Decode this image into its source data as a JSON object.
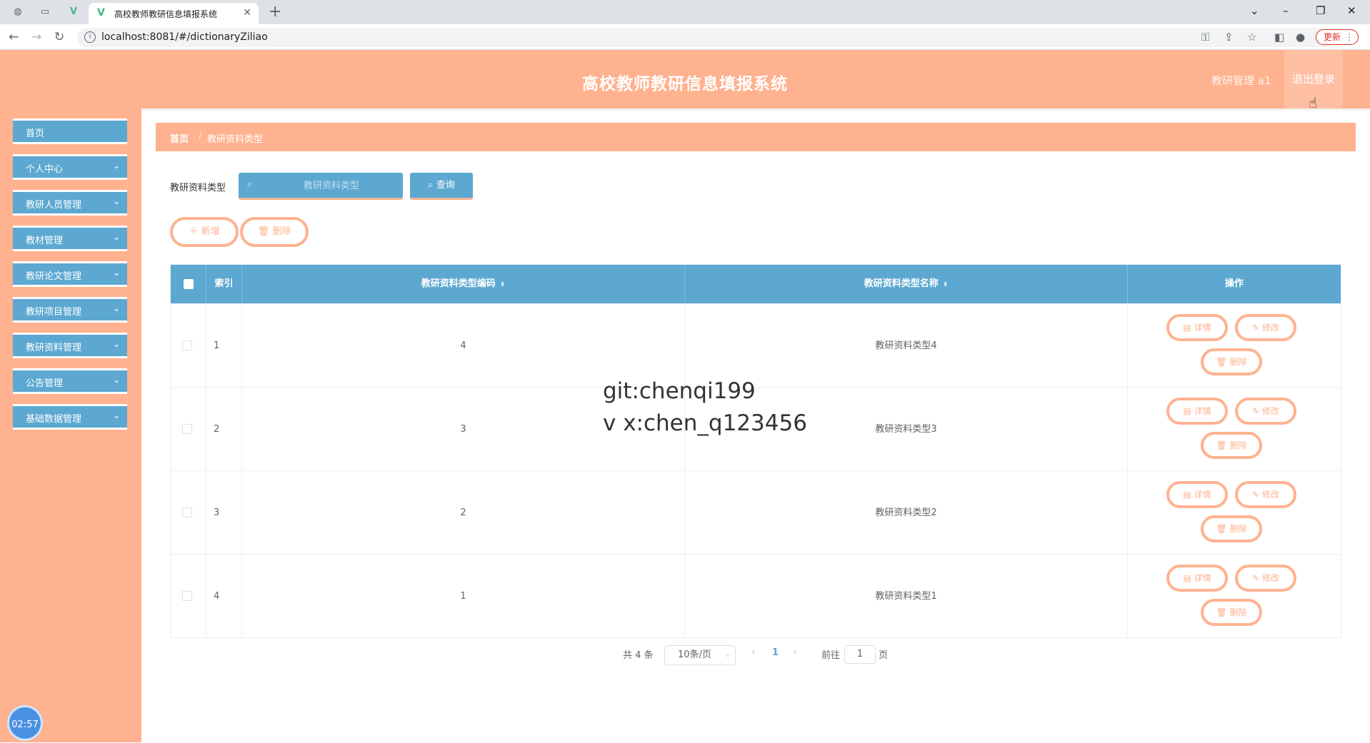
{
  "browser": {
    "tab_title": "高校教师教研信息填报系统",
    "url": "localhost:8081/#/dictionaryZiliao",
    "update_label": "更新"
  },
  "header": {
    "title": "高校教师教研信息填报系统",
    "user": "教研管理 a1",
    "logout": "退出登录"
  },
  "sidebar": {
    "items": [
      {
        "label": "首页",
        "has_arrow": false
      },
      {
        "label": "个人中心",
        "has_arrow": true
      },
      {
        "label": "教研人员管理",
        "has_arrow": true
      },
      {
        "label": "教材管理",
        "has_arrow": true
      },
      {
        "label": "教研论文管理",
        "has_arrow": true
      },
      {
        "label": "教研项目管理",
        "has_arrow": true
      },
      {
        "label": "教研资料管理",
        "has_arrow": true
      },
      {
        "label": "公告管理",
        "has_arrow": true
      },
      {
        "label": "基础数据管理",
        "has_arrow": true
      }
    ],
    "clock": "02:57"
  },
  "breadcrumb": {
    "home": "首页",
    "separator": "/",
    "current": "教研资料类型"
  },
  "search": {
    "label": "教研资料类型",
    "placeholder": "教研资料类型",
    "button": "查询"
  },
  "toolbar": {
    "add": "新增",
    "delete": "删除"
  },
  "table": {
    "columns": [
      "索引",
      "教研资料类型编码",
      "教研资料类型名称",
      "操作"
    ],
    "rows": [
      {
        "index": "1",
        "code": "4",
        "name": "教研资料类型4"
      },
      {
        "index": "2",
        "code": "3",
        "name": "教研资料类型3"
      },
      {
        "index": "3",
        "code": "2",
        "name": "教研资料类型2"
      },
      {
        "index": "4",
        "code": "1",
        "name": "教研资料类型1"
      }
    ],
    "actions": {
      "detail": "详情",
      "edit": "修改",
      "delete": "删除"
    }
  },
  "watermark": {
    "line1": "git:chenqi199",
    "line2": "v x:chen_q123456"
  },
  "pagination": {
    "total": "共 4 条",
    "page_size": "10条/页",
    "current_page": "1",
    "goto_label": "前往",
    "goto_value": "1",
    "goto_unit": "页"
  },
  "colors": {
    "accent_orange": "#ffb28f",
    "accent_blue": "#5ca8d1"
  }
}
